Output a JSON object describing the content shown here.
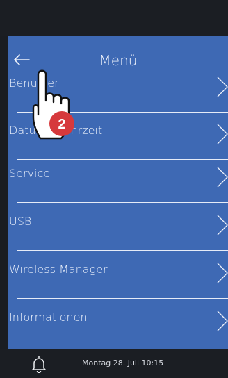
{
  "header": {
    "title": "Menü",
    "back_icon": "arrow-left-icon"
  },
  "menu": {
    "items": [
      {
        "label": "Benutzer"
      },
      {
        "label": "Datum & Uhrzeit"
      },
      {
        "label": "Service"
      },
      {
        "label": "USB"
      },
      {
        "label": "Wireless Manager"
      },
      {
        "label": "Informationen"
      }
    ],
    "chevron_icon": "chevron-right-icon"
  },
  "status_bar": {
    "bell_icon": "bell-icon",
    "datetime": "Montag 28. Juli 10:15"
  },
  "overlay": {
    "step_number": "2",
    "hand_icon": "pointing-hand-icon"
  },
  "colors": {
    "screen_bg": "#3e69b4",
    "frame": "#1b1e23",
    "badge": "#d6393c"
  }
}
